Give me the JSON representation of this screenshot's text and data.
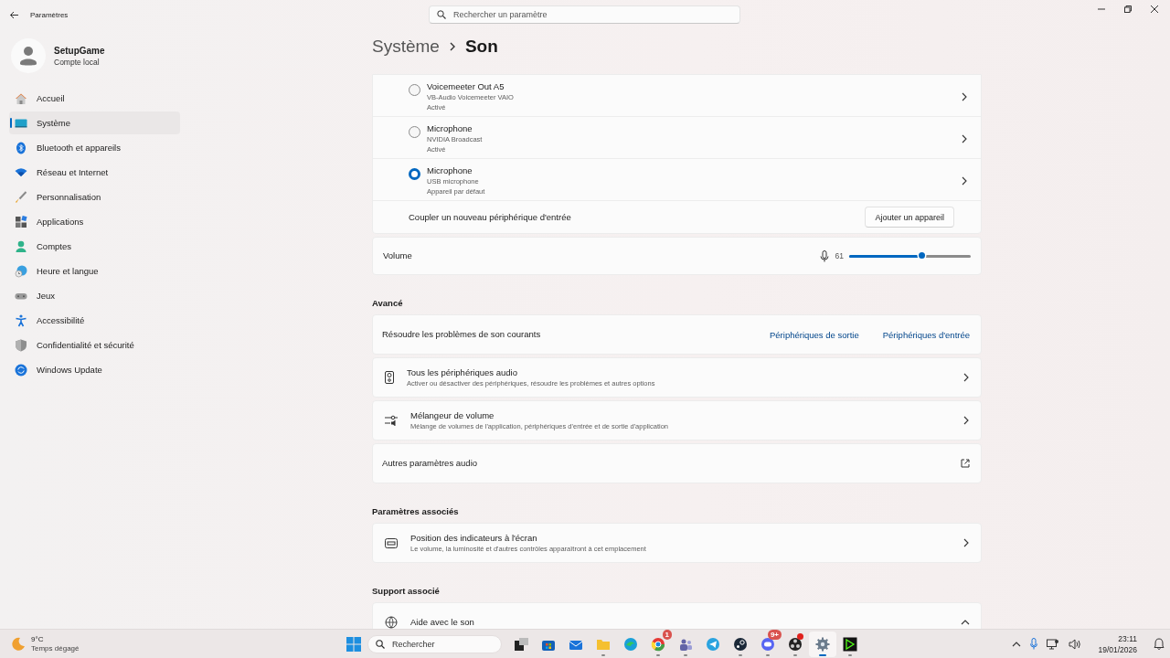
{
  "window": {
    "title": "Paramètres",
    "search": {
      "placeholder": "Rechercher un paramètre"
    }
  },
  "account": {
    "name": "SetupGame",
    "type": "Compte local"
  },
  "sidebar": {
    "items": [
      {
        "label": "Accueil",
        "selected": false
      },
      {
        "label": "Système",
        "selected": true
      },
      {
        "label": "Bluetooth et appareils",
        "selected": false
      },
      {
        "label": "Réseau et Internet",
        "selected": false
      },
      {
        "label": "Personnalisation",
        "selected": false
      },
      {
        "label": "Applications",
        "selected": false
      },
      {
        "label": "Comptes",
        "selected": false
      },
      {
        "label": "Heure et langue",
        "selected": false
      },
      {
        "label": "Jeux",
        "selected": false
      },
      {
        "label": "Accessibilité",
        "selected": false
      },
      {
        "label": "Confidentialité et sécurité",
        "selected": false
      },
      {
        "label": "Windows Update",
        "selected": false
      }
    ]
  },
  "breadcrumb": [
    "Système",
    "Son"
  ],
  "input_devices": [
    {
      "name": "Voicemeeter Out A5",
      "driver": "VB-Audio Voicemeeter VAIO",
      "status": "Activé",
      "selected": false
    },
    {
      "name": "Microphone",
      "driver": "NVIDIA Broadcast",
      "status": "Activé",
      "selected": false
    },
    {
      "name": "Microphone",
      "driver": "USB microphone",
      "status": "Appareil par défaut",
      "selected": true
    }
  ],
  "pair_row": {
    "label": "Coupler un nouveau périphérique d'entrée",
    "button": "Ajouter un appareil"
  },
  "volume": {
    "label": "Volume",
    "reading": "61",
    "level": 0.6
  },
  "sections": [
    {
      "title": "Avancé",
      "cards": [
        {
          "kind": "links",
          "title": "Résoudre les problèmes de son courants",
          "links": [
            "Périphériques de sortie",
            "Périphériques d'entrée"
          ]
        },
        {
          "kind": "nav",
          "title": "Tous les périphériques audio",
          "subtitle": "Activer ou désactiver des périphériques, résoudre les problèmes et autres options"
        },
        {
          "kind": "nav",
          "title": "Mélangeur de volume",
          "subtitle": "Mélange de volumes de l'application, périphériques d'entrée et de sortie d'application"
        },
        {
          "kind": "external",
          "title": "Autres paramètres audio"
        }
      ]
    },
    {
      "title": "Paramètres associés",
      "cards": [
        {
          "kind": "nav",
          "title": "Position des indicateurs à l'écran",
          "subtitle": "Le volume, la luminosité et d'autres contrôles apparaîtront à cet emplacement"
        }
      ]
    },
    {
      "title": "Support associé",
      "cards": [
        {
          "kind": "expander",
          "title": "Aide avec le son",
          "expanded": true
        }
      ]
    }
  ],
  "taskbar": {
    "weather": {
      "temp": "9°C",
      "desc": "Temps dégagé"
    },
    "search": {
      "placeholder": "Rechercher"
    },
    "apps": [
      {
        "selected": false,
        "running": false,
        "alert": false
      },
      {
        "selected": false,
        "running": false,
        "alert": false
      },
      {
        "selected": false,
        "running": false,
        "alert": false
      },
      {
        "selected": false,
        "running": true,
        "alert": false
      },
      {
        "selected": false,
        "running": false,
        "alert": false
      },
      {
        "selected": false,
        "running": true,
        "alert": false,
        "badge": "1"
      },
      {
        "selected": false,
        "running": true,
        "alert": false
      },
      {
        "selected": false,
        "running": false,
        "alert": false
      },
      {
        "selected": false,
        "running": true,
        "alert": false
      },
      {
        "selected": false,
        "running": true,
        "alert": false,
        "badge": "9+"
      },
      {
        "selected": false,
        "running": true,
        "alert": true
      },
      {
        "selected": true,
        "running": true,
        "alert": false
      },
      {
        "selected": false,
        "running": true,
        "alert": false
      }
    ],
    "clock": {
      "time": "23:11",
      "date": "19/01/2026"
    }
  }
}
